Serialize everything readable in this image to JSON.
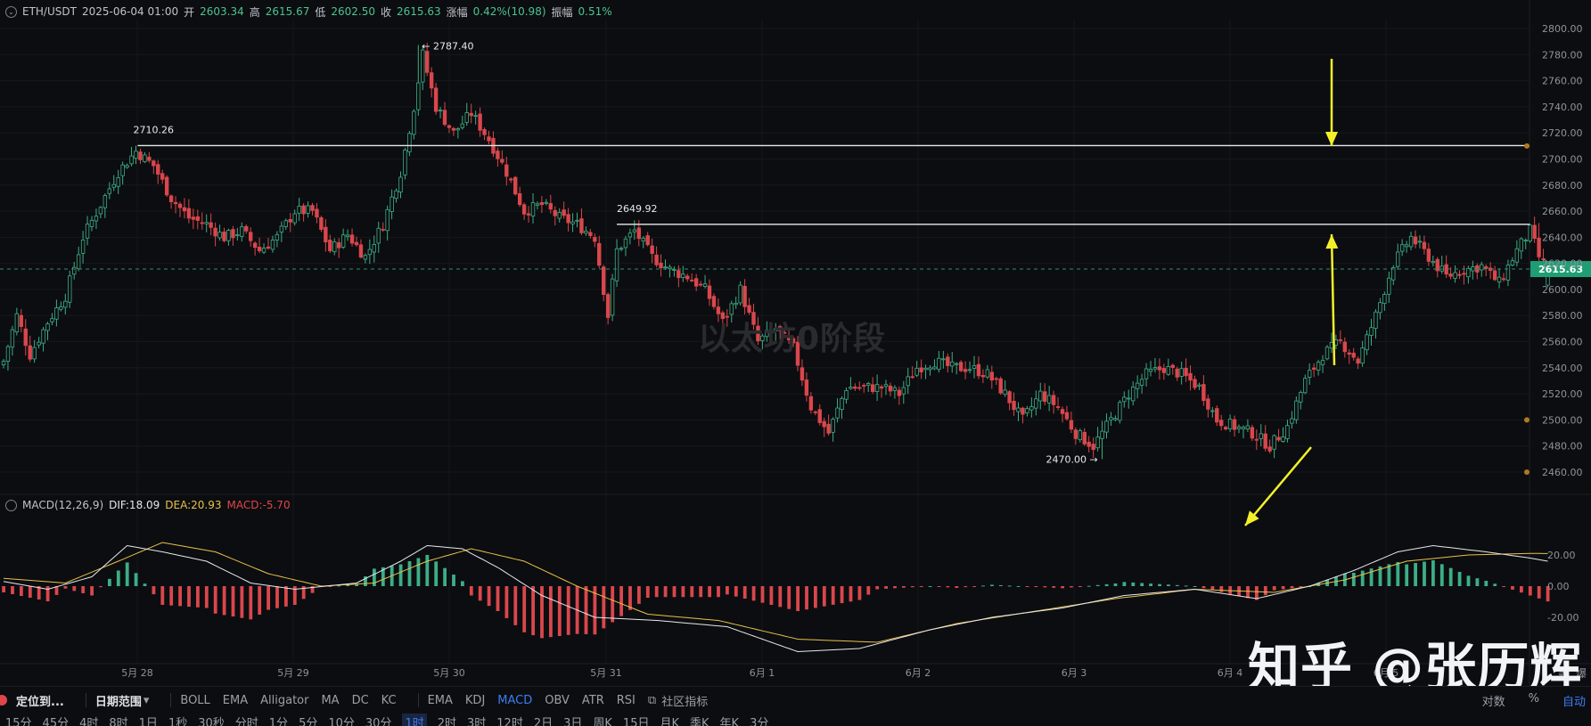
{
  "header": {
    "symbol": "ETH/USDT",
    "datetime": "2025-06-04 01:00",
    "open_label": "开",
    "open": "2603.34",
    "high_label": "高",
    "high": "2615.67",
    "low_label": "低",
    "low": "2602.50",
    "close_label": "收",
    "close": "2615.63",
    "change_label": "涨幅",
    "change": "0.42%(10.98)",
    "amp_label": "振幅",
    "amp": "0.51%"
  },
  "macd_header": {
    "name": "MACD(12,26,9)",
    "dif": "DIF:18.09",
    "dea": "DEA:20.93",
    "macd": "MACD:-5.70"
  },
  "overlay_title": "以太坊0阶段",
  "watermark": "知乎 @张历辉",
  "annotations": {
    "high_label": "← 2787.40",
    "low_label": "2470.00 →",
    "level1": "2710.26",
    "level2": "2649.92",
    "last_price": "2615.63"
  },
  "axis": {
    "price_ticks": [
      "2800.00",
      "2780.00",
      "2760.00",
      "2740.00",
      "2720.00",
      "2700.00",
      "2680.00",
      "2660.00",
      "2640.00",
      "2620.00",
      "2600.00",
      "2580.00",
      "2560.00",
      "2540.00",
      "2520.00",
      "2500.00",
      "2480.00",
      "2460.00"
    ],
    "macd_ticks": [
      "20.00",
      "0.00",
      "-20.00"
    ],
    "date_ticks": [
      "5月 28",
      "5月 29",
      "5月 30",
      "5月 31",
      "6月 1",
      "6月 2",
      "6月 3",
      "6月 4",
      "6月 5"
    ],
    "corner_labels": [
      "等",
      "爆"
    ]
  },
  "toolbar": {
    "goto": "定位到...",
    "range": "日期范围",
    "indicators": [
      "BOLL",
      "EMA",
      "Alligator",
      "MA",
      "DC",
      "KC"
    ],
    "sub_indicators": [
      "EMA",
      "KDJ",
      "MACD",
      "OBV",
      "ATR",
      "RSI"
    ],
    "active_sub": "MACD",
    "community": "社区指标",
    "right": [
      "对数",
      "%",
      "自动"
    ],
    "intervals": [
      "15分",
      "45分",
      "4时",
      "8时",
      "1日",
      "1秒",
      "30秒",
      "分时",
      "1分",
      "5分",
      "10分",
      "30分",
      "1时",
      "2时",
      "3时",
      "12时",
      "2日",
      "3日",
      "周K",
      "15日",
      "月K",
      "季K",
      "年K",
      "3分"
    ],
    "active_interval": "1时"
  },
  "colors": {
    "up": "#3cae86",
    "down": "#d9474c",
    "dif": "#e6e8ec",
    "dea": "#e8c14b",
    "arrow": "#f3f02a",
    "level": "#e8e9ec",
    "price_badge": "#1f9e74"
  },
  "chart_data": {
    "type": "candlestick",
    "interval": "1h",
    "x_range": [
      "2025-05-27 16:00",
      "2025-06-04 01:00"
    ],
    "ylim": [
      2450,
      2810
    ],
    "key_levels": [
      2710.26,
      2649.92
    ],
    "last_price": 2615.63,
    "period_high": 2787.4,
    "period_low": 2470.0,
    "close_path": [
      [
        0,
        2545
      ],
      [
        3,
        2580
      ],
      [
        6,
        2550
      ],
      [
        10,
        2575
      ],
      [
        14,
        2595
      ],
      [
        18,
        2640
      ],
      [
        22,
        2665
      ],
      [
        26,
        2690
      ],
      [
        30,
        2706
      ],
      [
        34,
        2695
      ],
      [
        38,
        2670
      ],
      [
        42,
        2655
      ],
      [
        46,
        2650
      ],
      [
        50,
        2640
      ],
      [
        54,
        2645
      ],
      [
        58,
        2630
      ],
      [
        62,
        2640
      ],
      [
        66,
        2660
      ],
      [
        70,
        2660
      ],
      [
        74,
        2630
      ],
      [
        78,
        2642
      ],
      [
        82,
        2625
      ],
      [
        86,
        2650
      ],
      [
        90,
        2690
      ],
      [
        93,
        2740
      ],
      [
        95,
        2780
      ],
      [
        98,
        2740
      ],
      [
        102,
        2720
      ],
      [
        106,
        2735
      ],
      [
        110,
        2715
      ],
      [
        114,
        2690
      ],
      [
        118,
        2660
      ],
      [
        122,
        2665
      ],
      [
        126,
        2655
      ],
      [
        130,
        2650
      ],
      [
        134,
        2640
      ],
      [
        137,
        2580
      ],
      [
        139,
        2630
      ],
      [
        143,
        2645
      ],
      [
        147,
        2625
      ],
      [
        151,
        2615
      ],
      [
        155,
        2610
      ],
      [
        159,
        2600
      ],
      [
        163,
        2575
      ],
      [
        167,
        2600
      ],
      [
        171,
        2560
      ],
      [
        175,
        2570
      ],
      [
        179,
        2555
      ],
      [
        183,
        2510
      ],
      [
        187,
        2490
      ],
      [
        191,
        2525
      ],
      [
        195,
        2525
      ],
      [
        199,
        2525
      ],
      [
        203,
        2520
      ],
      [
        207,
        2540
      ],
      [
        211,
        2545
      ],
      [
        215,
        2540
      ],
      [
        219,
        2540
      ],
      [
        223,
        2535
      ],
      [
        227,
        2520
      ],
      [
        231,
        2500
      ],
      [
        235,
        2520
      ],
      [
        239,
        2510
      ],
      [
        243,
        2490
      ],
      [
        247,
        2480
      ],
      [
        251,
        2500
      ],
      [
        255,
        2520
      ],
      [
        259,
        2535
      ],
      [
        263,
        2540
      ],
      [
        267,
        2535
      ],
      [
        271,
        2525
      ],
      [
        275,
        2500
      ],
      [
        279,
        2495
      ],
      [
        283,
        2490
      ],
      [
        287,
        2480
      ],
      [
        291,
        2495
      ],
      [
        295,
        2530
      ],
      [
        299,
        2550
      ],
      [
        303,
        2560
      ],
      [
        307,
        2545
      ],
      [
        311,
        2580
      ],
      [
        315,
        2620
      ],
      [
        319,
        2640
      ],
      [
        323,
        2625
      ],
      [
        327,
        2610
      ],
      [
        331,
        2615
      ],
      [
        335,
        2618
      ],
      [
        339,
        2605
      ],
      [
        343,
        2630
      ],
      [
        346,
        2645
      ],
      [
        348,
        2625
      ],
      [
        350,
        2616
      ]
    ],
    "macd": {
      "dif_path": [
        [
          0,
          3
        ],
        [
          10,
          -2
        ],
        [
          20,
          6
        ],
        [
          28,
          26
        ],
        [
          36,
          22
        ],
        [
          46,
          16
        ],
        [
          56,
          2
        ],
        [
          66,
          -2
        ],
        [
          80,
          2
        ],
        [
          90,
          16
        ],
        [
          96,
          26
        ],
        [
          104,
          24
        ],
        [
          112,
          12
        ],
        [
          122,
          -6
        ],
        [
          134,
          -20
        ],
        [
          148,
          -22
        ],
        [
          164,
          -26
        ],
        [
          180,
          -42
        ],
        [
          194,
          -40
        ],
        [
          210,
          -28
        ],
        [
          224,
          -20
        ],
        [
          240,
          -14
        ],
        [
          254,
          -6
        ],
        [
          270,
          -2
        ],
        [
          284,
          -8
        ],
        [
          296,
          0
        ],
        [
          306,
          10
        ],
        [
          316,
          22
        ],
        [
          324,
          26
        ],
        [
          336,
          22
        ],
        [
          346,
          18
        ],
        [
          350,
          16
        ]
      ],
      "dea_path": [
        [
          0,
          5
        ],
        [
          14,
          2
        ],
        [
          26,
          16
        ],
        [
          36,
          28
        ],
        [
          48,
          22
        ],
        [
          60,
          8
        ],
        [
          72,
          0
        ],
        [
          84,
          2
        ],
        [
          96,
          16
        ],
        [
          106,
          24
        ],
        [
          118,
          16
        ],
        [
          130,
          0
        ],
        [
          146,
          -18
        ],
        [
          162,
          -22
        ],
        [
          180,
          -34
        ],
        [
          198,
          -36
        ],
        [
          216,
          -24
        ],
        [
          234,
          -16
        ],
        [
          252,
          -8
        ],
        [
          270,
          -2
        ],
        [
          288,
          -4
        ],
        [
          304,
          4
        ],
        [
          318,
          16
        ],
        [
          332,
          20
        ],
        [
          346,
          21
        ],
        [
          350,
          20.9
        ]
      ],
      "hist_note": "histogram = 2*(DIF-DEA), green when >=0, red when <0"
    }
  }
}
